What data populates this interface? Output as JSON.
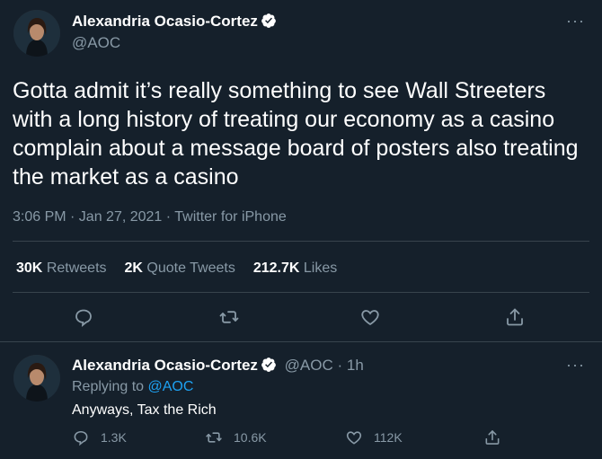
{
  "main_tweet": {
    "author_name": "Alexandria Ocasio-Cortez",
    "author_handle": "@AOC",
    "text": "Gotta admit it’s really something to see Wall Streeters with a long history of treating our economy as a casino complain about a message board of posters also treating the market as a casino",
    "timestamp": "3:06 PM · Jan 27, 2021 · Twitter for iPhone",
    "stats": {
      "retweets_count": "30K",
      "retweets_label": "Retweets",
      "quote_count": "2K",
      "quote_label": "Quote Tweets",
      "likes_count": "212.7K",
      "likes_label": "Likes"
    },
    "more_glyph": "···"
  },
  "reply_tweet": {
    "author_name": "Alexandria Ocasio-Cortez",
    "author_handle": "@AOC",
    "age": "1h",
    "handle_age_sep": "·",
    "replying_to_label": "Replying to",
    "replying_to_handle": "@AOC",
    "text": "Anyways, Tax the Rich",
    "reply_count": "1.3K",
    "retweet_count": "10.6K",
    "like_count": "112K",
    "more_glyph": "···"
  },
  "icons": [
    "verified-badge-icon",
    "reply-icon",
    "retweet-icon",
    "like-icon",
    "share-icon",
    "more-icon"
  ],
  "colors": {
    "background": "#15202b",
    "divider": "#38444d",
    "secondary_text": "#8899a6",
    "link": "#1da1f2"
  }
}
